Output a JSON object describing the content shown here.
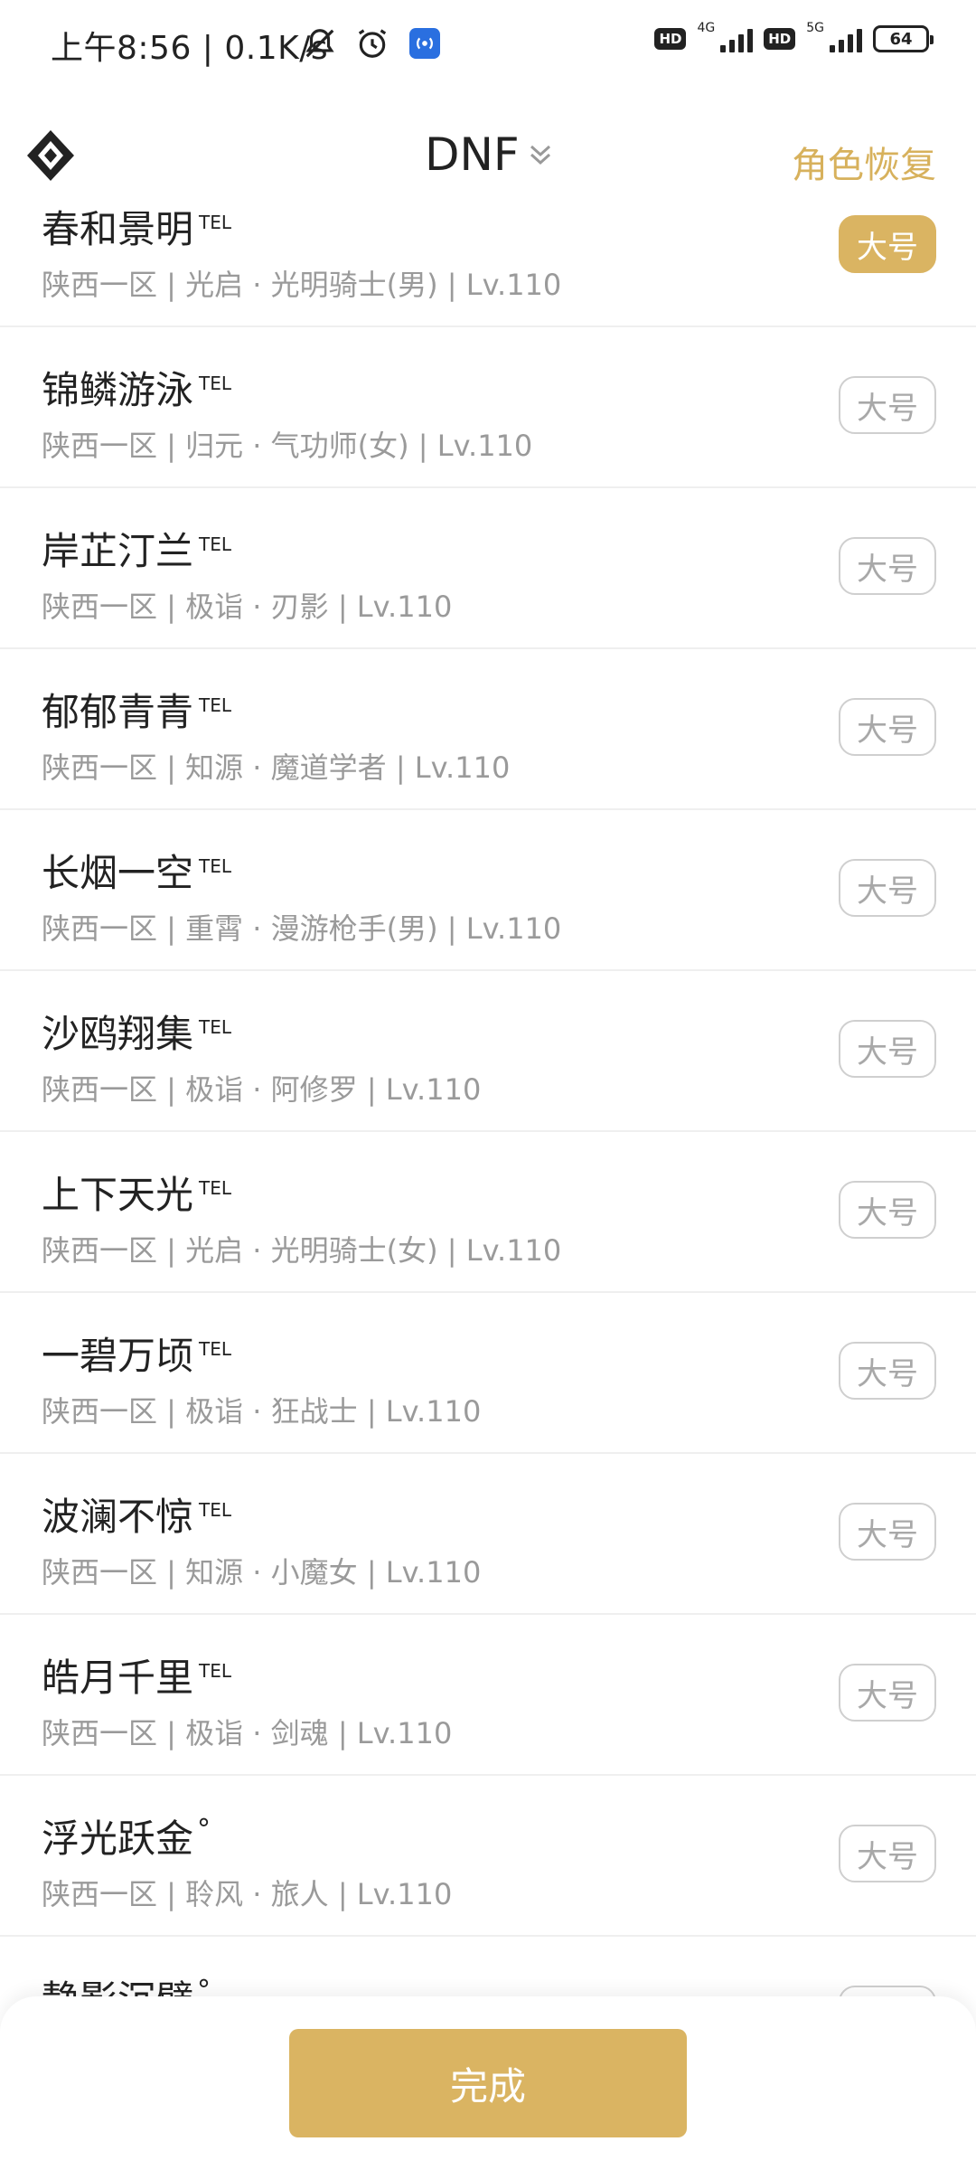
{
  "status_bar": {
    "time": "上午8:56 | 0.1K/s",
    "net1": "4G",
    "net2": "5G",
    "battery": "64",
    "hd": "HD"
  },
  "header": {
    "title": "DNF",
    "restore_label": "角色恢复"
  },
  "accent_color": "#dab462",
  "characters": [
    {
      "name": "春和景明",
      "badge": "TEL",
      "info": "陕西一区 | 光启 · 光明骑士(男) | Lv.110",
      "tag": "大号",
      "selected": true
    },
    {
      "name": "锦鳞游泳",
      "badge": "TEL",
      "info": "陕西一区 | 归元 · 气功师(女) | Lv.110",
      "tag": "大号",
      "selected": false
    },
    {
      "name": "岸芷汀兰",
      "badge": "TEL",
      "info": "陕西一区 | 极诣 · 刃影 | Lv.110",
      "tag": "大号",
      "selected": false
    },
    {
      "name": "郁郁青青",
      "badge": "TEL",
      "info": "陕西一区 | 知源 · 魔道学者 | Lv.110",
      "tag": "大号",
      "selected": false
    },
    {
      "name": "长烟一空",
      "badge": "TEL",
      "info": "陕西一区 | 重霄 · 漫游枪手(男) | Lv.110",
      "tag": "大号",
      "selected": false
    },
    {
      "name": "沙鸥翔集",
      "badge": "TEL",
      "info": "陕西一区 | 极诣 · 阿修罗 | Lv.110",
      "tag": "大号",
      "selected": false
    },
    {
      "name": "上下天光",
      "badge": "TEL",
      "info": "陕西一区 | 光启 · 光明骑士(女) | Lv.110",
      "tag": "大号",
      "selected": false
    },
    {
      "name": "一碧万顷",
      "badge": "TEL",
      "info": "陕西一区 | 极诣 · 狂战士 | Lv.110",
      "tag": "大号",
      "selected": false
    },
    {
      "name": "波澜不惊",
      "badge": "TEL",
      "info": "陕西一区 | 知源 · 小魔女 | Lv.110",
      "tag": "大号",
      "selected": false
    },
    {
      "name": "皓月千里",
      "badge": "TEL",
      "info": "陕西一区 | 极诣 · 剑魂 | Lv.110",
      "tag": "大号",
      "selected": false
    },
    {
      "name": "浮光跃金",
      "badge": "°",
      "info": "陕西一区 | 聆风 · 旅人 | Lv.110",
      "tag": "大号",
      "selected": false
    },
    {
      "name": "静影沉璧",
      "badge": "°",
      "info": "",
      "tag": "大号",
      "selected": false
    }
  ],
  "bottom": {
    "done_label": "完成"
  }
}
